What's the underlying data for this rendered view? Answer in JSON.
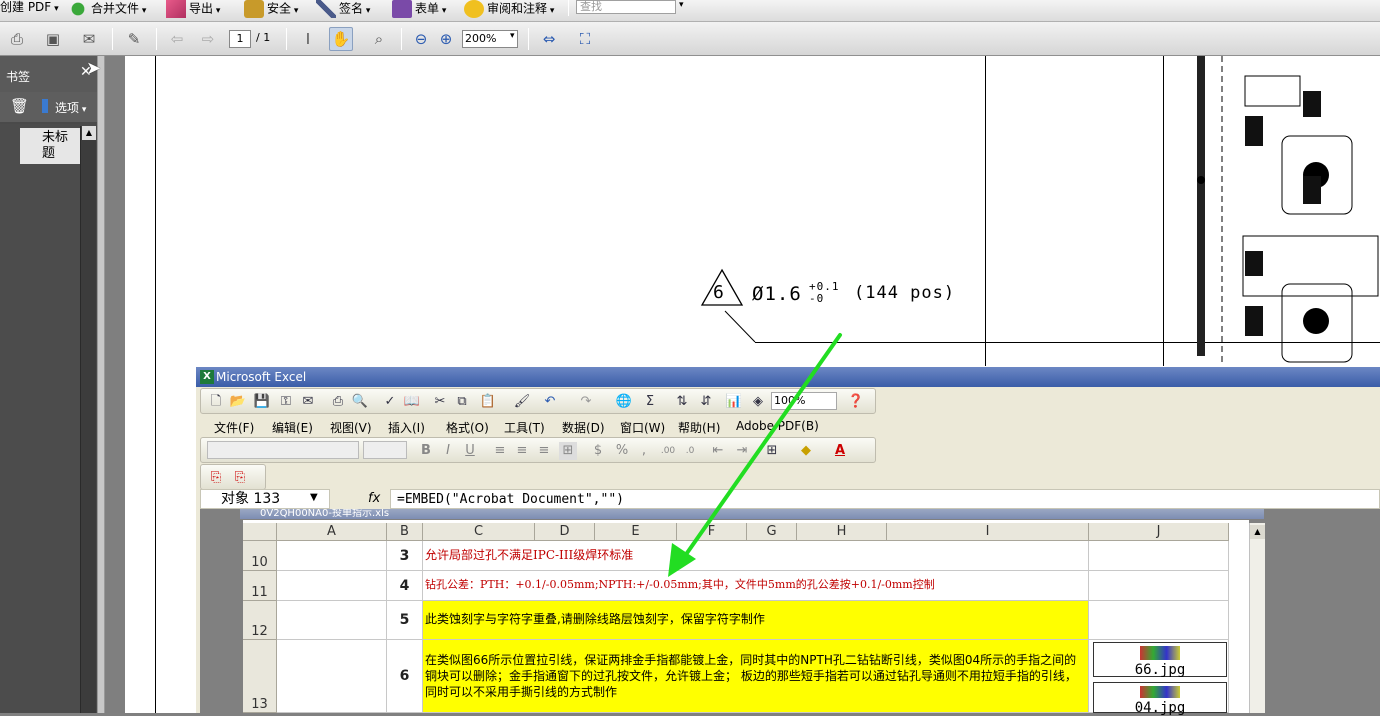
{
  "acrobat": {
    "menubar": {
      "create_pdf": "创建 PDF",
      "combine_files": "合并文件",
      "export": "导出",
      "secure": "安全",
      "sign": "签名",
      "forms": "表单",
      "review_comment": "审阅和注释",
      "find_placeholder": "查找"
    },
    "toolbar": {
      "page_current": "1",
      "page_total": "/ 1",
      "zoom": "200%"
    },
    "bookmarks": {
      "title": "书签",
      "options": "选项",
      "item_label": "未标题"
    },
    "drawing": {
      "callout_number": "6",
      "drill_note": "Ø1.6",
      "tol_plus": "+0.1",
      "tol_minus": "-0",
      "drill_count": "(144 pos)"
    }
  },
  "excel": {
    "title": "Microsoft Excel",
    "menus": [
      "文件(F)",
      "编辑(E)",
      "视图(V)",
      "插入(I)",
      "格式(O)",
      "工具(T)",
      "数据(D)",
      "窗口(W)",
      "帮助(H)",
      "Adobe PDF(B)"
    ],
    "zoom": "100%",
    "name_box": "对象 133",
    "fx_label": "fx",
    "formula": "=EMBED(\"Acrobat Document\",\"\")",
    "embedded_title": "0V2QH00NA0-投单指示.xls",
    "columns": [
      "A",
      "B",
      "C",
      "D",
      "E",
      "F",
      "G",
      "H",
      "I",
      "J"
    ],
    "rows": [
      {
        "row": "10",
        "no": "3",
        "text": "允许局部过孔不满足IPC-III级焊环标准"
      },
      {
        "row": "11",
        "no": "4",
        "text": "钻孔公差：PTH：+0.1/-0.05mm;NPTH:+/-0.05mm;其中，文件中5mm的孔公差按+0.1/-0mm控制"
      },
      {
        "row": "12",
        "no": "5",
        "text": "此类蚀刻字与字符字重叠,请删除线路层蚀刻字，保留字符字制作"
      },
      {
        "row": "13",
        "no": "6",
        "text": "在类似图66所示位置拉引线，保证两排金手指都能镀上金，同时其中的NPTH孔二钻钻断引线，类似图04所示的手指之间的铜块可以删除；金手指通窗下的过孔按文件，允许镀上金；  板边的那些短手指若可以通过钻孔导通则不用拉短手指的引线，同时可以不采用手撕引线的方式制作"
      }
    ],
    "attachments": [
      "66.jpg",
      "04.jpg"
    ]
  },
  "colors": {
    "highlight": "#ffff00",
    "note_red": "#c00000",
    "arrow": "#22dd22"
  }
}
